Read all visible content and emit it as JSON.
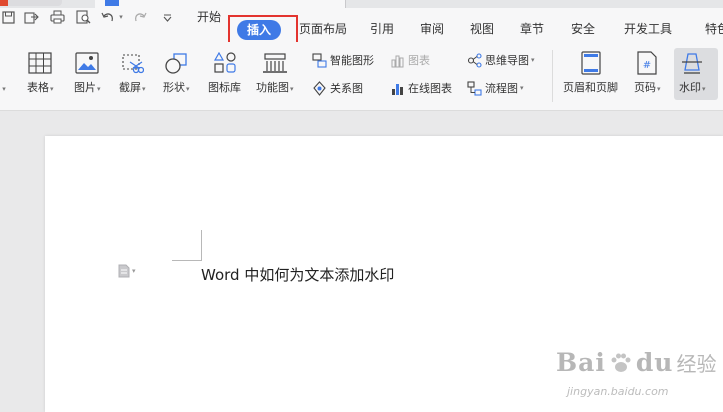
{
  "menu_tabs": [
    "开始",
    "插入",
    "页面布局",
    "引用",
    "审阅",
    "视图",
    "章节",
    "安全",
    "开发工具",
    "特色"
  ],
  "active_tab": "插入",
  "ribbon": {
    "table": "表格",
    "picture": "图片",
    "screenshot": "截屏",
    "shapes": "形状",
    "icon_library": "图标库",
    "function_chart": "功能图",
    "smart_art": "智能图形",
    "chart": "图表",
    "relation_chart": "关系图",
    "online_chart": "在线图表",
    "mind_map": "思维导图",
    "flowchart": "流程图",
    "header_footer": "页眉和页脚",
    "page_number": "页码",
    "watermark": "水印"
  },
  "document": {
    "line1": "Word 中如何为文本添加水印"
  },
  "watermark_brand": {
    "text": "Bai",
    "text2": "du",
    "cn": "经验",
    "url": "jingyan.baidu.com"
  },
  "colors": {
    "accent": "#3f7ae6",
    "highlight_box": "#e3342f"
  }
}
